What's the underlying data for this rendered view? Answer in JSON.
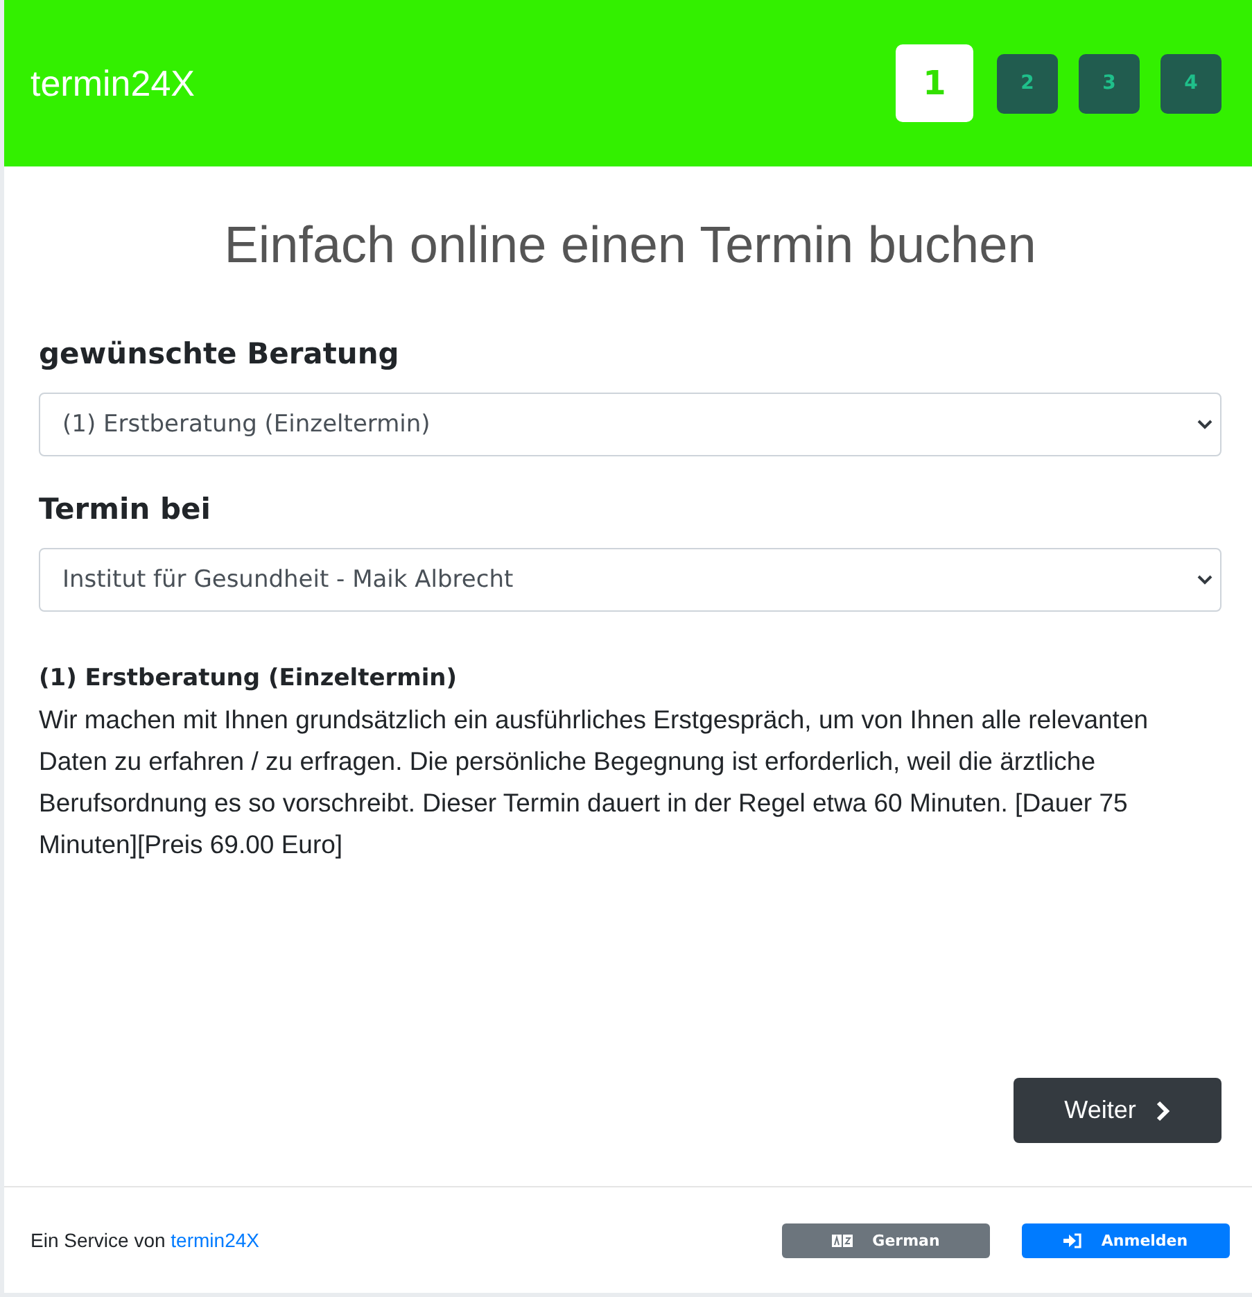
{
  "header": {
    "brand": "termin24X",
    "steps": [
      {
        "label": "1",
        "selected": true
      },
      {
        "label": "2",
        "selected": false
      },
      {
        "label": "3",
        "selected": false
      },
      {
        "label": "4",
        "selected": false
      }
    ]
  },
  "title": "Einfach online einen Termin buchen",
  "fields": [
    {
      "label": "gewünschte Beratung",
      "value": "(1) Erstberatung (Einzeltermin)"
    },
    {
      "label": "Termin bei",
      "value": "Institut für Gesundheit - Maik Albrecht"
    }
  ],
  "description": {
    "heading": "(1) Erstberatung (Einzeltermin)",
    "text": "Wir machen mit Ihnen grundsätzlich ein ausführliches Erstgespräch, um von Ihnen alle relevanten Daten zu erfahren / zu erfragen. Die persönliche Begegnung ist erforderlich, weil die ärztliche Berufsordnung es so vorschreibt. Dieser Termin dauert in der Regel etwa 60 Minuten. [Dauer 75 Minuten][Preis 69.00 Euro]"
  },
  "next_button": "Weiter",
  "footer": {
    "text": "Ein Service von",
    "link": "termin24X",
    "language_button": "German",
    "login_button": "Anmelden"
  }
}
